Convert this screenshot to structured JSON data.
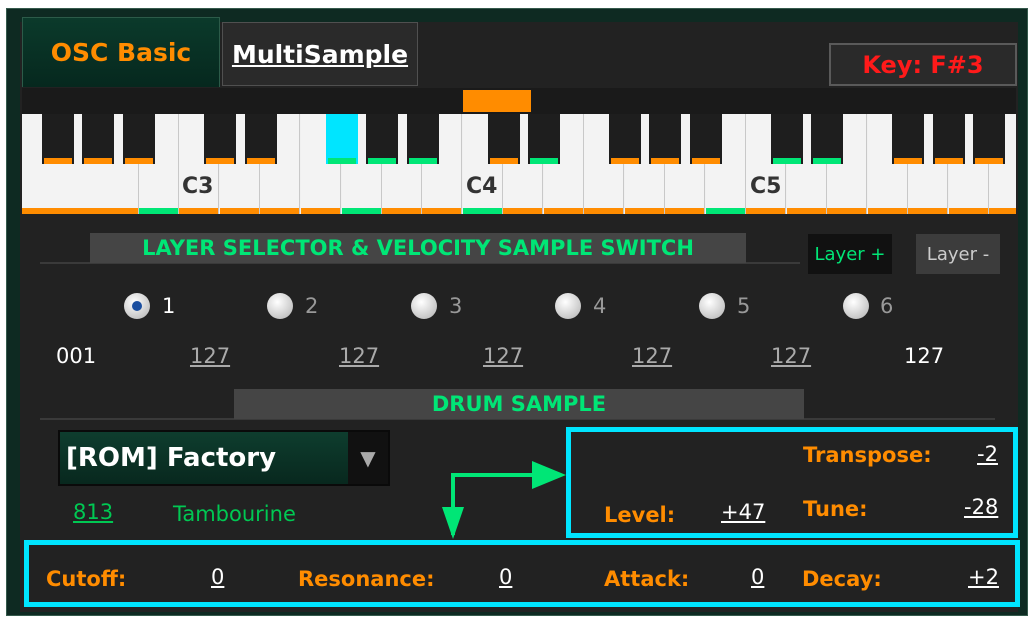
{
  "tabs": [
    {
      "label": "OSC Basic",
      "active": true
    },
    {
      "label": "MultiSample",
      "active": false
    }
  ],
  "key_display": "Key: F#3",
  "keyboard": {
    "octave_labels": [
      "C3",
      "C4",
      "C5"
    ],
    "pressed_key": "F#3"
  },
  "layer_section": {
    "title": "LAYER SELECTOR & VELOCITY SAMPLE SWITCH",
    "layer_plus": "Layer +",
    "layer_minus": "Layer -",
    "radios": [
      "1",
      "2",
      "3",
      "4",
      "5",
      "6"
    ],
    "selected": "1",
    "velocities": [
      "001",
      "127",
      "127",
      "127",
      "127",
      "127",
      "127"
    ]
  },
  "drum_section": {
    "title": "DRUM SAMPLE",
    "bank": "[ROM] Factory",
    "sample_number": "813",
    "sample_name": "Tambourine"
  },
  "params": {
    "transpose": {
      "label": "Transpose:",
      "value": "-2"
    },
    "level": {
      "label": "Level:",
      "value": "+47"
    },
    "tune": {
      "label": "Tune:",
      "value": "-28"
    },
    "cutoff": {
      "label": "Cutoff:",
      "value": "0"
    },
    "resonance": {
      "label": "Resonance:",
      "value": "0"
    },
    "attack": {
      "label": "Attack:",
      "value": "0"
    },
    "decay": {
      "label": "Decay:",
      "value": "+2"
    }
  },
  "colors": {
    "accent_orange": "#ff8c00",
    "accent_green": "#00e676",
    "highlight_cyan": "#00e5ff",
    "key_red": "#ff1a1a"
  }
}
